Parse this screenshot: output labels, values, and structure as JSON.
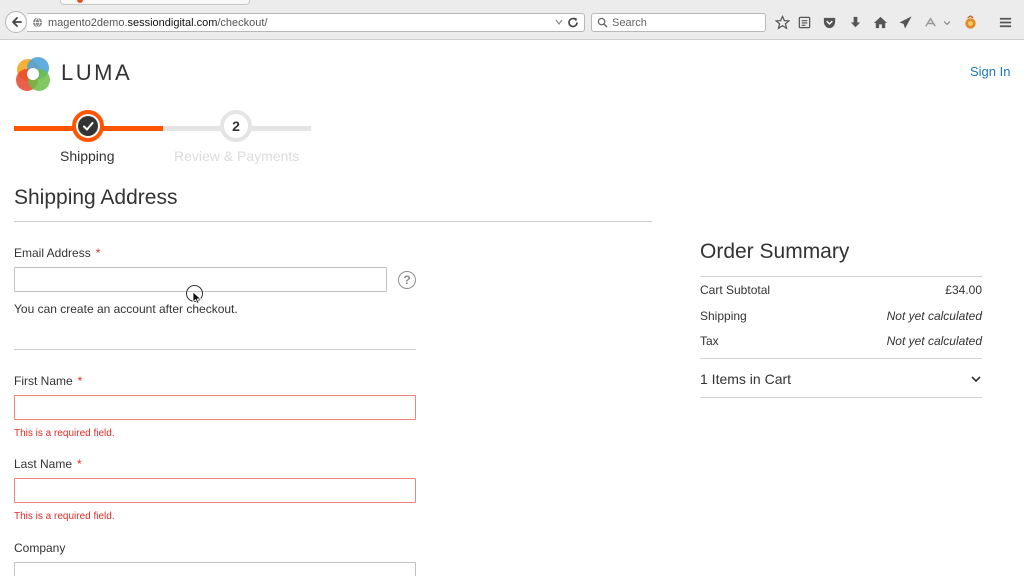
{
  "browser": {
    "url_prefix": "magento2demo.",
    "url_domain": "sessiondigital.com",
    "url_path": "/checkout/",
    "search_placeholder": "Search",
    "toolbar_icons": [
      "bookmark-star-icon",
      "reading-list-icon",
      "pocket-icon",
      "download-icon",
      "home-icon",
      "send-icon",
      "extension-icon",
      "addon-icon",
      "menu-icon"
    ]
  },
  "header": {
    "brand": "LUMA",
    "sign_in": "Sign In"
  },
  "progress": {
    "steps": [
      {
        "number": "",
        "label": "Shipping",
        "state": "complete"
      },
      {
        "number": "2",
        "label": "Review & Payments",
        "state": "upcoming"
      }
    ],
    "accent_color": "#ff5501"
  },
  "shipping": {
    "title": "Shipping Address",
    "email_label": "Email Address",
    "email_value": "",
    "email_note": "You can create an account after checkout.",
    "help_glyph": "?",
    "required_marker": "*",
    "first_name_label": "First Name",
    "first_name_value": "",
    "first_name_error": "This is a required field.",
    "last_name_label": "Last Name",
    "last_name_value": "",
    "last_name_error": "This is a required field.",
    "company_label": "Company",
    "company_value": ""
  },
  "summary": {
    "title": "Order Summary",
    "rows": [
      {
        "label": "Cart Subtotal",
        "value": "£34.00"
      },
      {
        "label": "Shipping",
        "value": "Not yet calculated"
      },
      {
        "label": "Tax",
        "value": "Not yet calculated"
      }
    ],
    "items_label": "1 Items in Cart"
  },
  "colors": {
    "link": "#1979c3",
    "error": "#e02b27",
    "accent": "#ff5501"
  }
}
